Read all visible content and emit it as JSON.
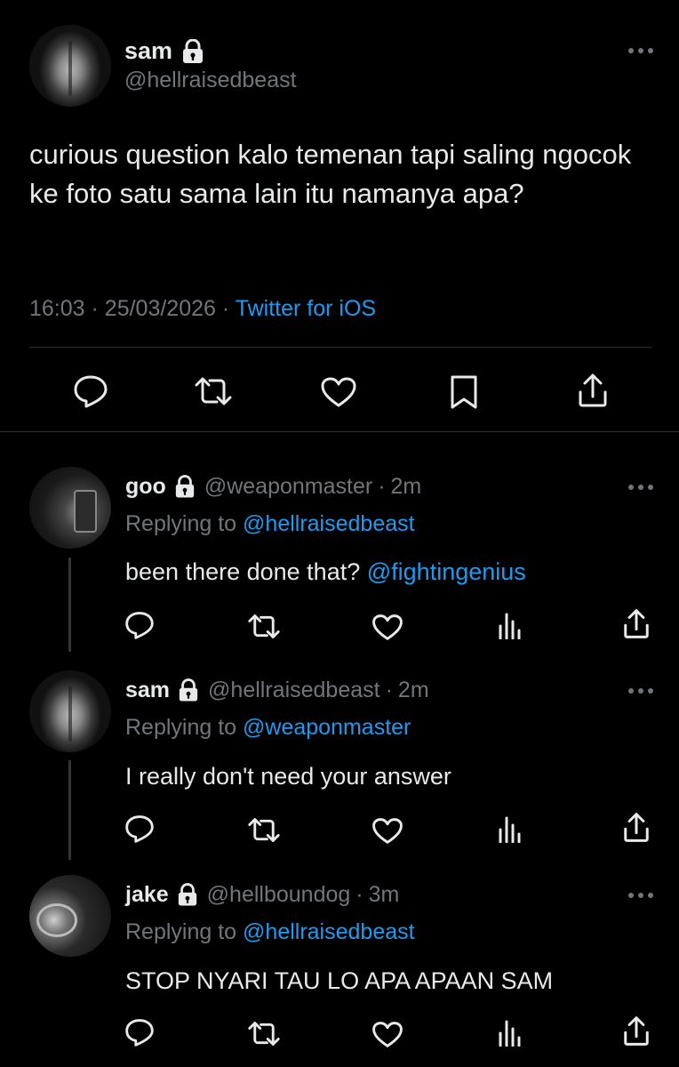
{
  "main_tweet": {
    "name": "sam",
    "handle": "@hellraisedbeast",
    "text": "curious question kalo temenan tapi saling ngocok ke foto satu sama lain itu namanya apa?",
    "time": "16:03",
    "dot1": "·",
    "date": "25/03/2026",
    "dot2": "·",
    "source": "Twitter for iOS",
    "actions": [
      "reply-icon",
      "retweet-icon",
      "like-icon",
      "bookmark-icon",
      "share-icon"
    ]
  },
  "replies": [
    {
      "name": "goo",
      "handle": "@weaponmaster",
      "dot": "·",
      "time": "2m",
      "replying_prefix": "Replying to",
      "replying_to": "@hellraisedbeast",
      "text": "been there done that?",
      "text_mention": "@fightingenius"
    },
    {
      "name": "sam",
      "handle": "@hellraisedbeast",
      "dot": "·",
      "time": "2m",
      "replying_prefix": "Replying to",
      "replying_to": "@weaponmaster",
      "text": "I really don't need your answer"
    },
    {
      "name": "jake",
      "handle": "@hellboundog",
      "dot": "·",
      "time": "3m",
      "replying_prefix": "Replying to",
      "replying_to": "@hellraisedbeast",
      "text": "STOP NYARI TAU LO APA APAAN SAM"
    }
  ],
  "colors": {
    "background": "#000000",
    "text": "#e7e9ea",
    "secondary": "#71767b",
    "accent": "#1d9bf0",
    "divider": "#2f3336"
  }
}
